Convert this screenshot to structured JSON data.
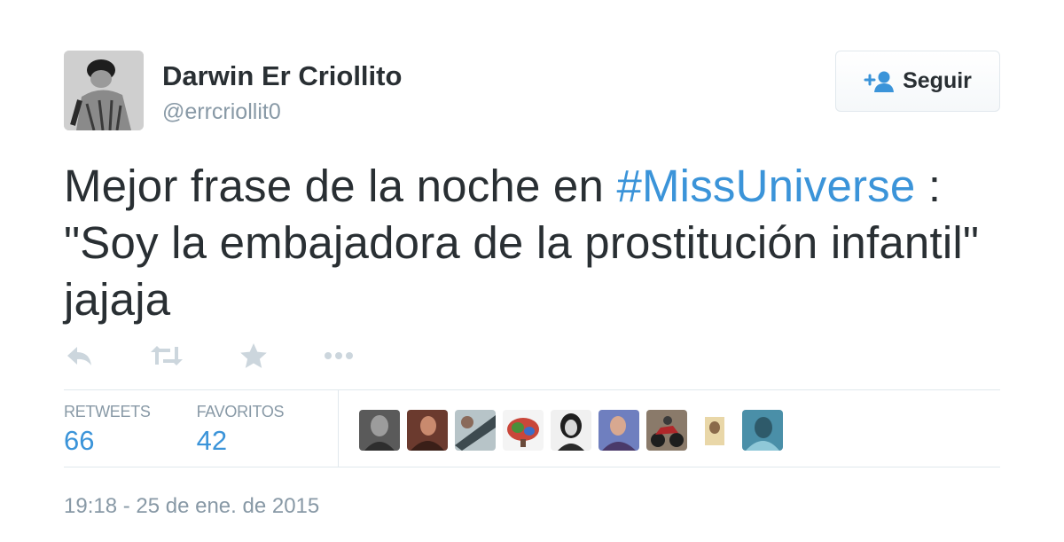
{
  "author": {
    "name": "Darwin Er Criollito",
    "handle": "@errcriollit0",
    "avatar": "profile-photo-grayscale"
  },
  "follow_button": {
    "label": "Seguir",
    "icon": "add-user-icon"
  },
  "tweet": {
    "text_before": "Mejor frase de la noche en ",
    "hashtag": "#MissUniverse",
    "text_after": " : \"Soy la embajadora de la prostitución infantil\" jajaja"
  },
  "actions": [
    {
      "icon": "reply-icon"
    },
    {
      "icon": "retweet-icon"
    },
    {
      "icon": "favorite-icon"
    },
    {
      "icon": "more-icon"
    }
  ],
  "stats": {
    "retweets_label": "RETWEETS",
    "retweets_count": "66",
    "favorites_label": "FAVORITOS",
    "favorites_count": "42"
  },
  "favorited_by": [
    {
      "name": "favoriter-avatar-1"
    },
    {
      "name": "favoriter-avatar-2"
    },
    {
      "name": "favoriter-avatar-3"
    },
    {
      "name": "favoriter-avatar-4"
    },
    {
      "name": "favoriter-avatar-5"
    },
    {
      "name": "favoriter-avatar-6"
    },
    {
      "name": "favoriter-avatar-7"
    },
    {
      "name": "favoriter-avatar-8"
    },
    {
      "name": "favoriter-avatar-9"
    }
  ],
  "timestamp": "19:18 - 25 de ene. de 2015",
  "colors": {
    "link": "#3b94d9",
    "text": "#292f33",
    "muted": "#8899a6",
    "icon": "#ccd6dd",
    "border": "#e1e8ed"
  }
}
